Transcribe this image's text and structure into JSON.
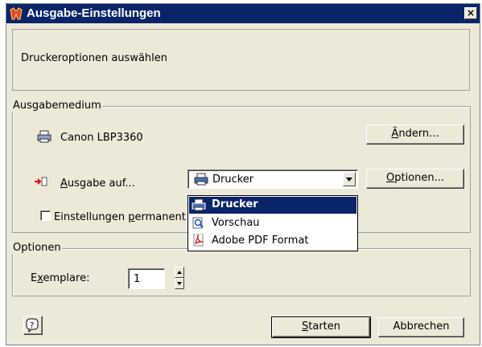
{
  "window": {
    "title": "Ausgabe-Einstellungen",
    "close_label": "×"
  },
  "banner": {
    "text": "Druckeroptionen auswählen"
  },
  "output_group": {
    "legend": "Ausgabemedium",
    "printer_name": "Canon LBP3360",
    "change_button": {
      "accel": "Ä",
      "rest": "ndern..."
    },
    "output_label": {
      "accel": "A",
      "rest": "usgabe auf..."
    },
    "options_button": {
      "accel": "O",
      "rest": "ptionen..."
    },
    "combo_value": "Drucker",
    "dropdown_items": [
      "Drucker",
      "Vorschau",
      "Adobe PDF Format"
    ],
    "selected_index": 0,
    "persist_checkbox": {
      "pre": "Einstellungen ",
      "accel": "p",
      "rest": "ermanent"
    },
    "persist_checked": false
  },
  "options_group": {
    "legend": "Optionen",
    "copies_label": {
      "pre": "E",
      "accel": "x",
      "rest": "emplare:"
    },
    "copies_value": "1"
  },
  "footer": {
    "help_label": "?",
    "start_button": {
      "accel": "S",
      "rest": "tarten"
    },
    "cancel_button": "Abbrechen"
  },
  "colors": {
    "title_bar": "#0a246a",
    "dialog_bg": "#ece9d8",
    "selection": "#0a246a"
  }
}
